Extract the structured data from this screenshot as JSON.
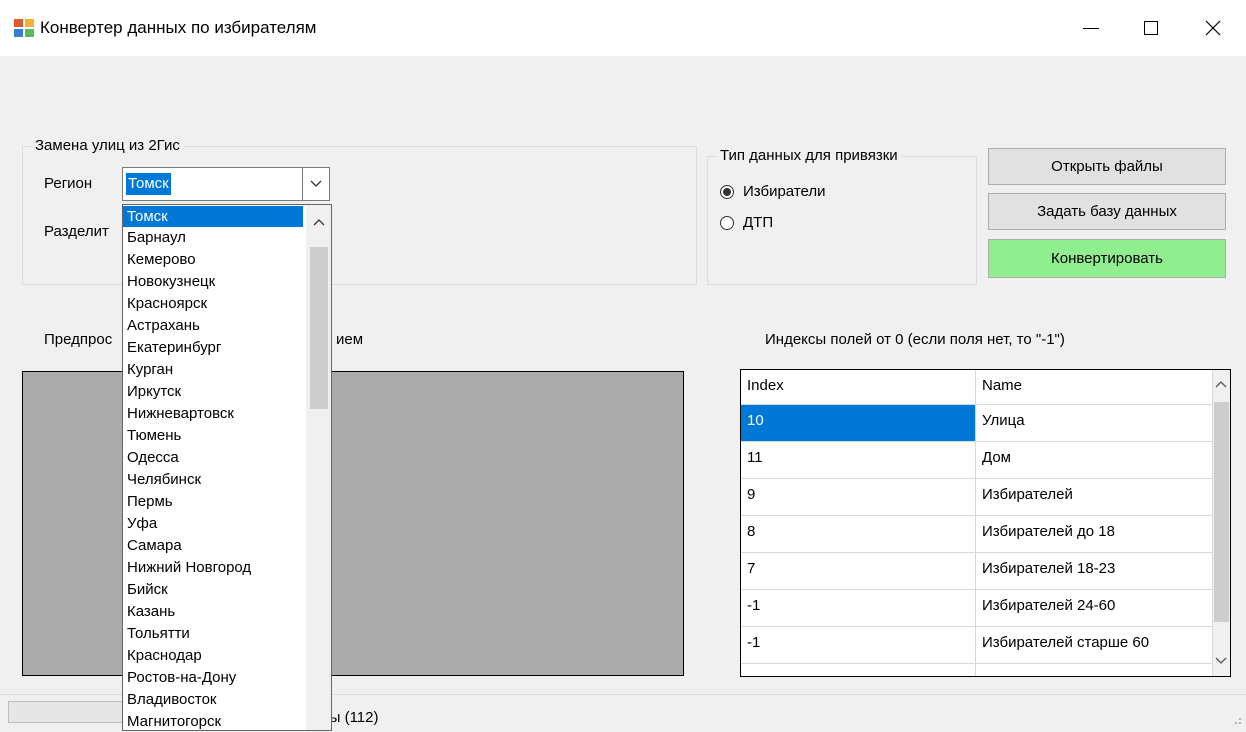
{
  "window": {
    "title": "Конвертер данных по избирателям",
    "icon": "app-icon"
  },
  "streets_group": {
    "title": "Замена улиц из 2Гис",
    "region_label": "Регион",
    "region_value": "Томск",
    "separator_label": "Разделит"
  },
  "dropdown": {
    "items": [
      "Томск",
      "Барнаул",
      "Кемерово",
      "Новокузнецк",
      "Красноярск",
      "Астрахань",
      "Екатеринбург",
      "Курган",
      "Иркутск",
      "Нижневартовск",
      "Тюмень",
      "Одесса",
      "Челябинск",
      "Пермь",
      "Уфа",
      "Самара",
      "Нижний Новгород",
      "Бийск",
      "Казань",
      "Тольятти",
      "Краснодар",
      "Ростов-на-Дону",
      "Владивосток",
      "Магнитогорск"
    ],
    "selected": "Томск"
  },
  "type_group": {
    "title": "Тип данных для привязки",
    "options": [
      {
        "label": "Избиратели",
        "checked": true
      },
      {
        "label": "ДТП",
        "checked": false
      }
    ]
  },
  "buttons": {
    "open_files": "Открыть файлы",
    "set_db": "Задать базу данных",
    "convert": "Конвертировать",
    "convert_color": "#90ee90"
  },
  "preview": {
    "label_left": "Предпрос",
    "label_right": "ием"
  },
  "indexes": {
    "label": "Индексы полей от 0 (если поля нет, то \"-1\")",
    "columns": [
      "Index",
      "Name"
    ],
    "rows": [
      {
        "index": "10",
        "name": "Улица"
      },
      {
        "index": "11",
        "name": "Дом"
      },
      {
        "index": "9",
        "name": "Избирателей"
      },
      {
        "index": "8",
        "name": "Избирателей до 18"
      },
      {
        "index": "7",
        "name": "Избирателей 18-23"
      },
      {
        "index": "-1",
        "name": "Избирателей 24-60"
      },
      {
        "index": "-1",
        "name": "Избирателей старше 60"
      }
    ]
  },
  "status": {
    "text": "ены (112)"
  }
}
